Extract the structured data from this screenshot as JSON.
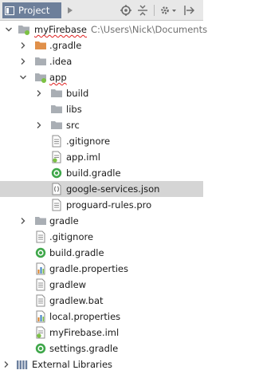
{
  "toolbar": {
    "view_label": "Project",
    "icons": [
      "dropdown-arrow-icon",
      "target-icon",
      "collapse-all-icon",
      "settings-icon",
      "hide-icon"
    ]
  },
  "tree": {
    "root": {
      "label": "myFirebase",
      "path": "C:\\Users\\Nick\\Documents"
    },
    "dot_gradle": ".gradle",
    "idea": ".idea",
    "app": {
      "label": "app",
      "build": "build",
      "libs": "libs",
      "src": "src",
      "gitignore": ".gitignore",
      "iml": "app.iml",
      "build_gradle": "build.gradle",
      "google_services": "google-services.json",
      "proguard": "proguard-rules.pro"
    },
    "gradle_dir": "gradle",
    "gitignore": ".gitignore",
    "build_gradle": "build.gradle",
    "gradle_properties": "gradle.properties",
    "gradlew": "gradlew",
    "gradlew_bat": "gradlew.bat",
    "local_properties": "local.properties",
    "project_iml": "myFirebase.iml",
    "settings_gradle": "settings.gradle",
    "external_libraries": "External Libraries"
  },
  "colors": {
    "folder": "#a9aeb4",
    "folder_orange": "#e0904a",
    "module_dot": "#7cc243",
    "gradle_green": "#3fa74a",
    "selection": "#d5d5d5",
    "tab": "#6d7f9a"
  }
}
